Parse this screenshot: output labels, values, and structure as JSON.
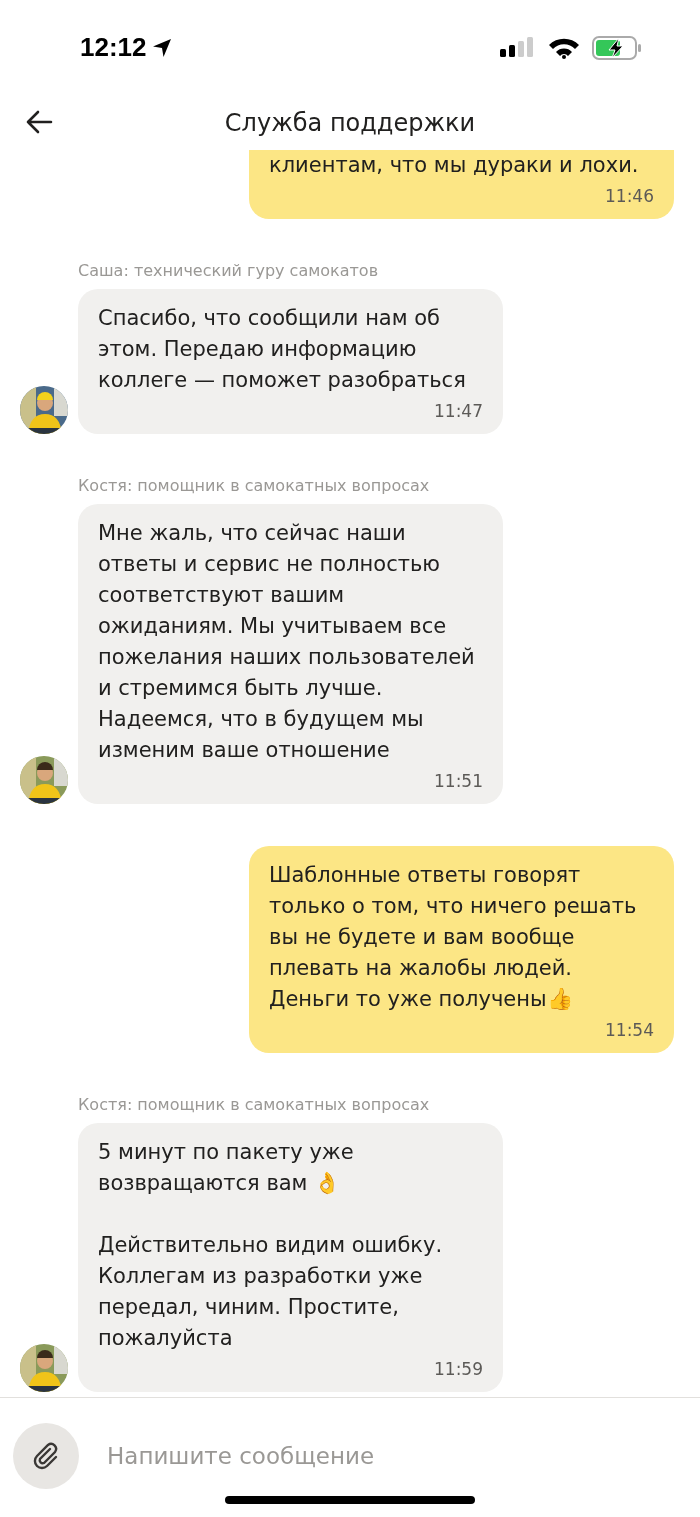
{
  "status_bar": {
    "time": "12:12"
  },
  "header": {
    "title": "Служба поддержки"
  },
  "messages": [
    {
      "kind": "outgoing",
      "text": "клиентам, что мы дураки и лохи.",
      "time": "11:46"
    },
    {
      "kind": "incoming",
      "sender": "Саша: технический гуру самокатов",
      "text": "Спасибо, что сообщили нам об этом. Передаю информацию коллеге — поможет разобраться",
      "time": "11:47"
    },
    {
      "kind": "incoming",
      "sender": "Костя: помощник в самокатных вопросах",
      "text": "Мне жаль, что сейчас наши ответы и сервис не полностью соответствуют вашим ожиданиям. Мы учитываем все пожелания наших пользователей и стремимся быть лучше. Надеемся, что в будущем мы изменим ваше отношение",
      "time": "11:51"
    },
    {
      "kind": "outgoing",
      "text": "Шаблонные ответы говорят только о том, что ничего решать вы не будете и вам вообще плевать на жалобы людей. Деньги то уже получены👍",
      "time": "11:54"
    },
    {
      "kind": "incoming",
      "sender": "Костя: помощник в самокатных вопросах",
      "text": "5 минут по пакету уже возвращаются вам 👌\n\nДействительно видим ошибку. Коллегам из разработки уже передал, чиним. Простите, пожалуйста",
      "time": "11:59"
    }
  ],
  "composer": {
    "placeholder": "Напишите сообщение"
  }
}
